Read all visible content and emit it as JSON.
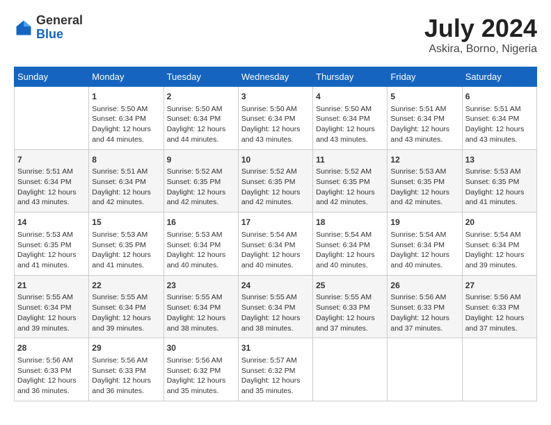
{
  "logo": {
    "general": "General",
    "blue": "Blue"
  },
  "title": "July 2024",
  "subtitle": "Askira, Borno, Nigeria",
  "days_header": [
    "Sunday",
    "Monday",
    "Tuesday",
    "Wednesday",
    "Thursday",
    "Friday",
    "Saturday"
  ],
  "weeks": [
    [
      {
        "day": "",
        "content": ""
      },
      {
        "day": "1",
        "content": "Sunrise: 5:50 AM\nSunset: 6:34 PM\nDaylight: 12 hours\nand 44 minutes."
      },
      {
        "day": "2",
        "content": "Sunrise: 5:50 AM\nSunset: 6:34 PM\nDaylight: 12 hours\nand 44 minutes."
      },
      {
        "day": "3",
        "content": "Sunrise: 5:50 AM\nSunset: 6:34 PM\nDaylight: 12 hours\nand 43 minutes."
      },
      {
        "day": "4",
        "content": "Sunrise: 5:50 AM\nSunset: 6:34 PM\nDaylight: 12 hours\nand 43 minutes."
      },
      {
        "day": "5",
        "content": "Sunrise: 5:51 AM\nSunset: 6:34 PM\nDaylight: 12 hours\nand 43 minutes."
      },
      {
        "day": "6",
        "content": "Sunrise: 5:51 AM\nSunset: 6:34 PM\nDaylight: 12 hours\nand 43 minutes."
      }
    ],
    [
      {
        "day": "7",
        "content": "Sunrise: 5:51 AM\nSunset: 6:34 PM\nDaylight: 12 hours\nand 43 minutes."
      },
      {
        "day": "8",
        "content": "Sunrise: 5:51 AM\nSunset: 6:34 PM\nDaylight: 12 hours\nand 42 minutes."
      },
      {
        "day": "9",
        "content": "Sunrise: 5:52 AM\nSunset: 6:35 PM\nDaylight: 12 hours\nand 42 minutes."
      },
      {
        "day": "10",
        "content": "Sunrise: 5:52 AM\nSunset: 6:35 PM\nDaylight: 12 hours\nand 42 minutes."
      },
      {
        "day": "11",
        "content": "Sunrise: 5:52 AM\nSunset: 6:35 PM\nDaylight: 12 hours\nand 42 minutes."
      },
      {
        "day": "12",
        "content": "Sunrise: 5:53 AM\nSunset: 6:35 PM\nDaylight: 12 hours\nand 42 minutes."
      },
      {
        "day": "13",
        "content": "Sunrise: 5:53 AM\nSunset: 6:35 PM\nDaylight: 12 hours\nand 41 minutes."
      }
    ],
    [
      {
        "day": "14",
        "content": "Sunrise: 5:53 AM\nSunset: 6:35 PM\nDaylight: 12 hours\nand 41 minutes."
      },
      {
        "day": "15",
        "content": "Sunrise: 5:53 AM\nSunset: 6:35 PM\nDaylight: 12 hours\nand 41 minutes."
      },
      {
        "day": "16",
        "content": "Sunrise: 5:53 AM\nSunset: 6:34 PM\nDaylight: 12 hours\nand 40 minutes."
      },
      {
        "day": "17",
        "content": "Sunrise: 5:54 AM\nSunset: 6:34 PM\nDaylight: 12 hours\nand 40 minutes."
      },
      {
        "day": "18",
        "content": "Sunrise: 5:54 AM\nSunset: 6:34 PM\nDaylight: 12 hours\nand 40 minutes."
      },
      {
        "day": "19",
        "content": "Sunrise: 5:54 AM\nSunset: 6:34 PM\nDaylight: 12 hours\nand 40 minutes."
      },
      {
        "day": "20",
        "content": "Sunrise: 5:54 AM\nSunset: 6:34 PM\nDaylight: 12 hours\nand 39 minutes."
      }
    ],
    [
      {
        "day": "21",
        "content": "Sunrise: 5:55 AM\nSunset: 6:34 PM\nDaylight: 12 hours\nand 39 minutes."
      },
      {
        "day": "22",
        "content": "Sunrise: 5:55 AM\nSunset: 6:34 PM\nDaylight: 12 hours\nand 39 minutes."
      },
      {
        "day": "23",
        "content": "Sunrise: 5:55 AM\nSunset: 6:34 PM\nDaylight: 12 hours\nand 38 minutes."
      },
      {
        "day": "24",
        "content": "Sunrise: 5:55 AM\nSunset: 6:34 PM\nDaylight: 12 hours\nand 38 minutes."
      },
      {
        "day": "25",
        "content": "Sunrise: 5:55 AM\nSunset: 6:33 PM\nDaylight: 12 hours\nand 37 minutes."
      },
      {
        "day": "26",
        "content": "Sunrise: 5:56 AM\nSunset: 6:33 PM\nDaylight: 12 hours\nand 37 minutes."
      },
      {
        "day": "27",
        "content": "Sunrise: 5:56 AM\nSunset: 6:33 PM\nDaylight: 12 hours\nand 37 minutes."
      }
    ],
    [
      {
        "day": "28",
        "content": "Sunrise: 5:56 AM\nSunset: 6:33 PM\nDaylight: 12 hours\nand 36 minutes."
      },
      {
        "day": "29",
        "content": "Sunrise: 5:56 AM\nSunset: 6:33 PM\nDaylight: 12 hours\nand 36 minutes."
      },
      {
        "day": "30",
        "content": "Sunrise: 5:56 AM\nSunset: 6:32 PM\nDaylight: 12 hours\nand 35 minutes."
      },
      {
        "day": "31",
        "content": "Sunrise: 5:57 AM\nSunset: 6:32 PM\nDaylight: 12 hours\nand 35 minutes."
      },
      {
        "day": "",
        "content": ""
      },
      {
        "day": "",
        "content": ""
      },
      {
        "day": "",
        "content": ""
      }
    ]
  ]
}
